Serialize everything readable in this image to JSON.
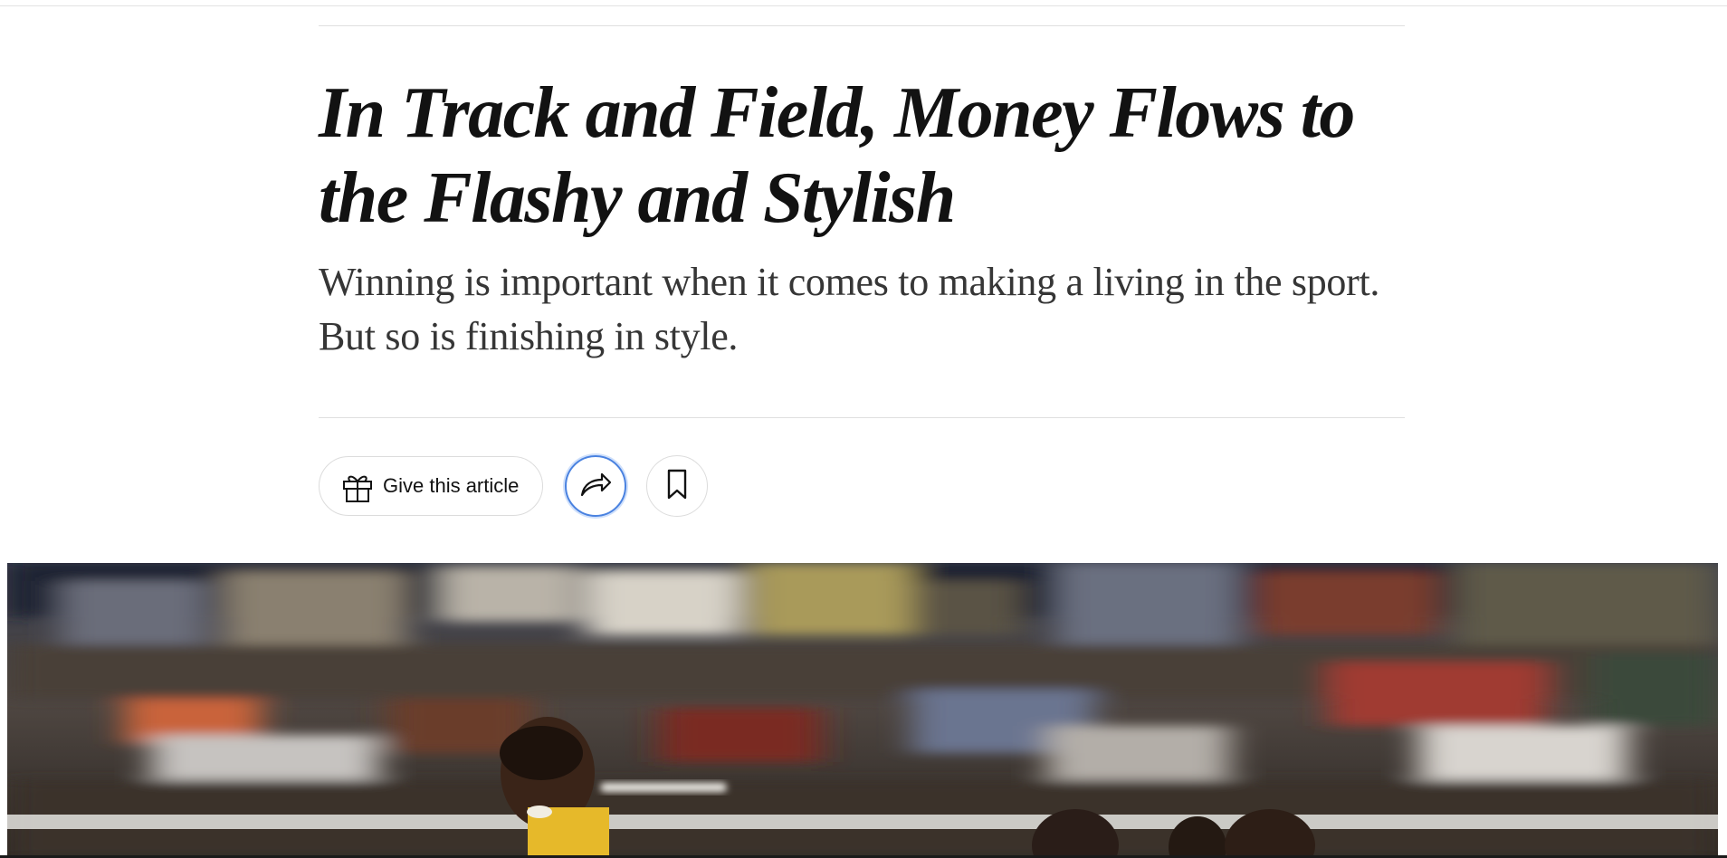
{
  "article": {
    "headline": "In Track and Field, Money Flows to the Flashy and Stylish",
    "summary": "Winning is important when it comes to making a living in the sport. But so is finishing in style."
  },
  "toolbar": {
    "gift_label": "Give this article",
    "gift_icon": "gift-icon",
    "share_icon": "share-arrow-icon",
    "save_icon": "bookmark-icon"
  },
  "hero": {
    "description_icon": "photo-of-sprinters"
  },
  "colors": {
    "focus_ring": "#4a82e0",
    "text_primary": "#121212",
    "text_secondary": "#363636",
    "divider": "#dfdfdf"
  }
}
